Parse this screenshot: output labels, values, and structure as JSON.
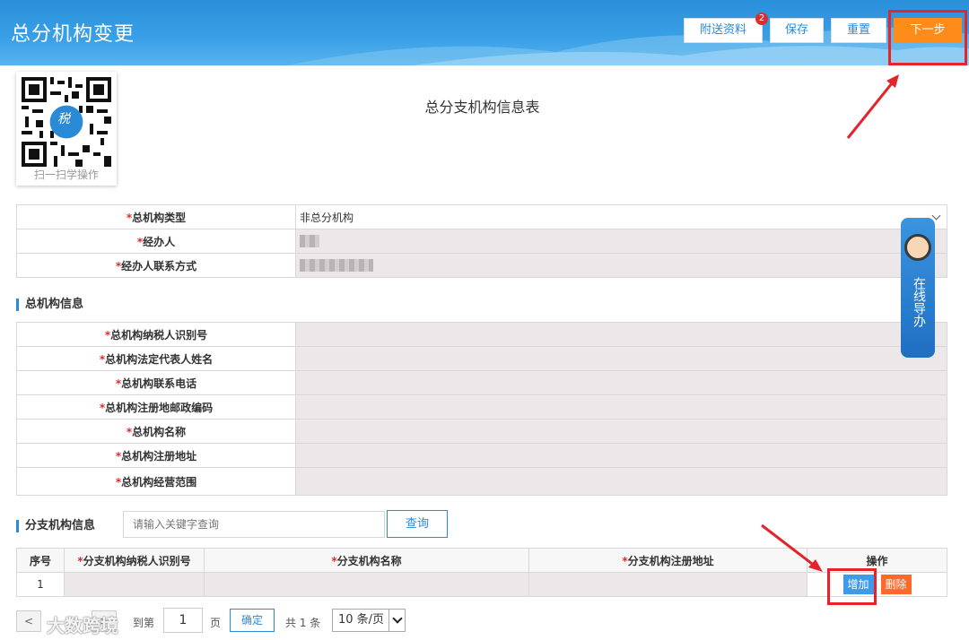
{
  "header": {
    "title": "总分机构变更",
    "buttons": {
      "attach": "附送资料",
      "attach_badge": "2",
      "save": "保存",
      "reset": "重置",
      "next": "下一步"
    }
  },
  "qr": {
    "caption": "扫一扫学操作",
    "logo_text": "税"
  },
  "form_title": "总分支机构信息表",
  "basic": [
    {
      "label": "总机构类型",
      "value": "非总分机构"
    },
    {
      "label": "经办人",
      "value": ""
    },
    {
      "label": "经办人联系方式",
      "value": ""
    }
  ],
  "head_section": {
    "title": "总机构信息",
    "rows": [
      {
        "label": "总机构纳税人识别号"
      },
      {
        "label": "总机构法定代表人姓名"
      },
      {
        "label": "总机构联系电话"
      },
      {
        "label": "总机构注册地邮政编码"
      },
      {
        "label": "总机构名称"
      },
      {
        "label": "总机构注册地址"
      },
      {
        "label": "总机构经营范围"
      }
    ]
  },
  "branch_section": {
    "title": "分支机构信息",
    "search_placeholder": "请输入关键字查询",
    "search_button": "查询",
    "columns": [
      "序号",
      "分支机构纳税人识别号",
      "分支机构名称",
      "分支机构注册地址",
      "操作"
    ],
    "rows": [
      {
        "index": "1"
      }
    ],
    "add_button": "增加",
    "delete_button": "删除"
  },
  "pager": {
    "prev": "<",
    "next": ">",
    "goto_label": "到第",
    "page_value": "1",
    "page_unit": "页",
    "confirm": "确定",
    "total": "共 1 条",
    "page_size": "10 条/页"
  },
  "guide": {
    "label": "在线导办"
  },
  "watermark": "大数跨境",
  "colors": {
    "header": "#3aa0e6",
    "accent": "#2a8ad6",
    "next": "#ff8c1a",
    "delete": "#ff6a2a",
    "highlight": "#e4242b"
  }
}
